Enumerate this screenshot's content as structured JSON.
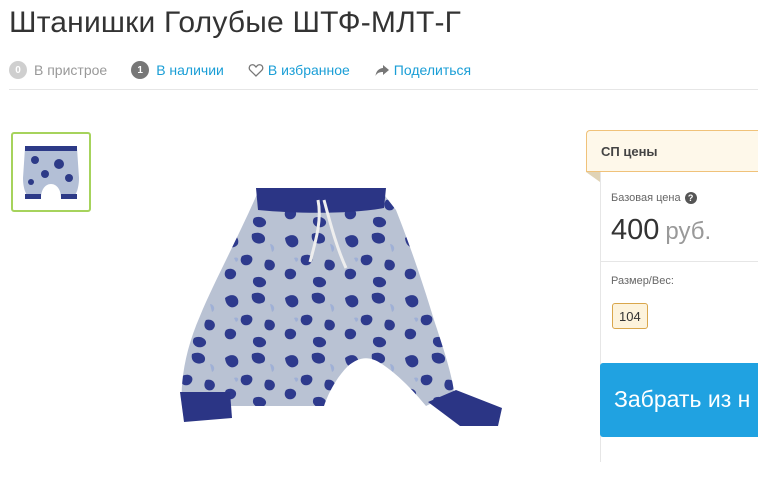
{
  "product": {
    "title": "Штанишки Голубые ШТФ-МЛТ-Г"
  },
  "meta": {
    "attached_count": "0",
    "attached_label": "В пристрое",
    "stock_count": "1",
    "stock_label": "В наличии",
    "favorite_label": "В избранное",
    "share_label": "Поделиться",
    "favorite_icon": "heart-icon",
    "share_icon": "share-arrow-icon"
  },
  "gallery": {
    "thumbnail_count": 1,
    "selected_border_color": "#a6d35c"
  },
  "price_panel": {
    "header": "СП цены",
    "base_price_label": "Базовая цена",
    "base_price_value": "400",
    "currency": "руб.",
    "size_label": "Размер/Вес:",
    "size_option": "104",
    "help_icon": "question-circle-icon"
  },
  "buy": {
    "label": "Забрать из н",
    "color": "#20a2e1"
  },
  "colors": {
    "link": "#1a9ed6",
    "accent_orange": "#f0c27a"
  }
}
